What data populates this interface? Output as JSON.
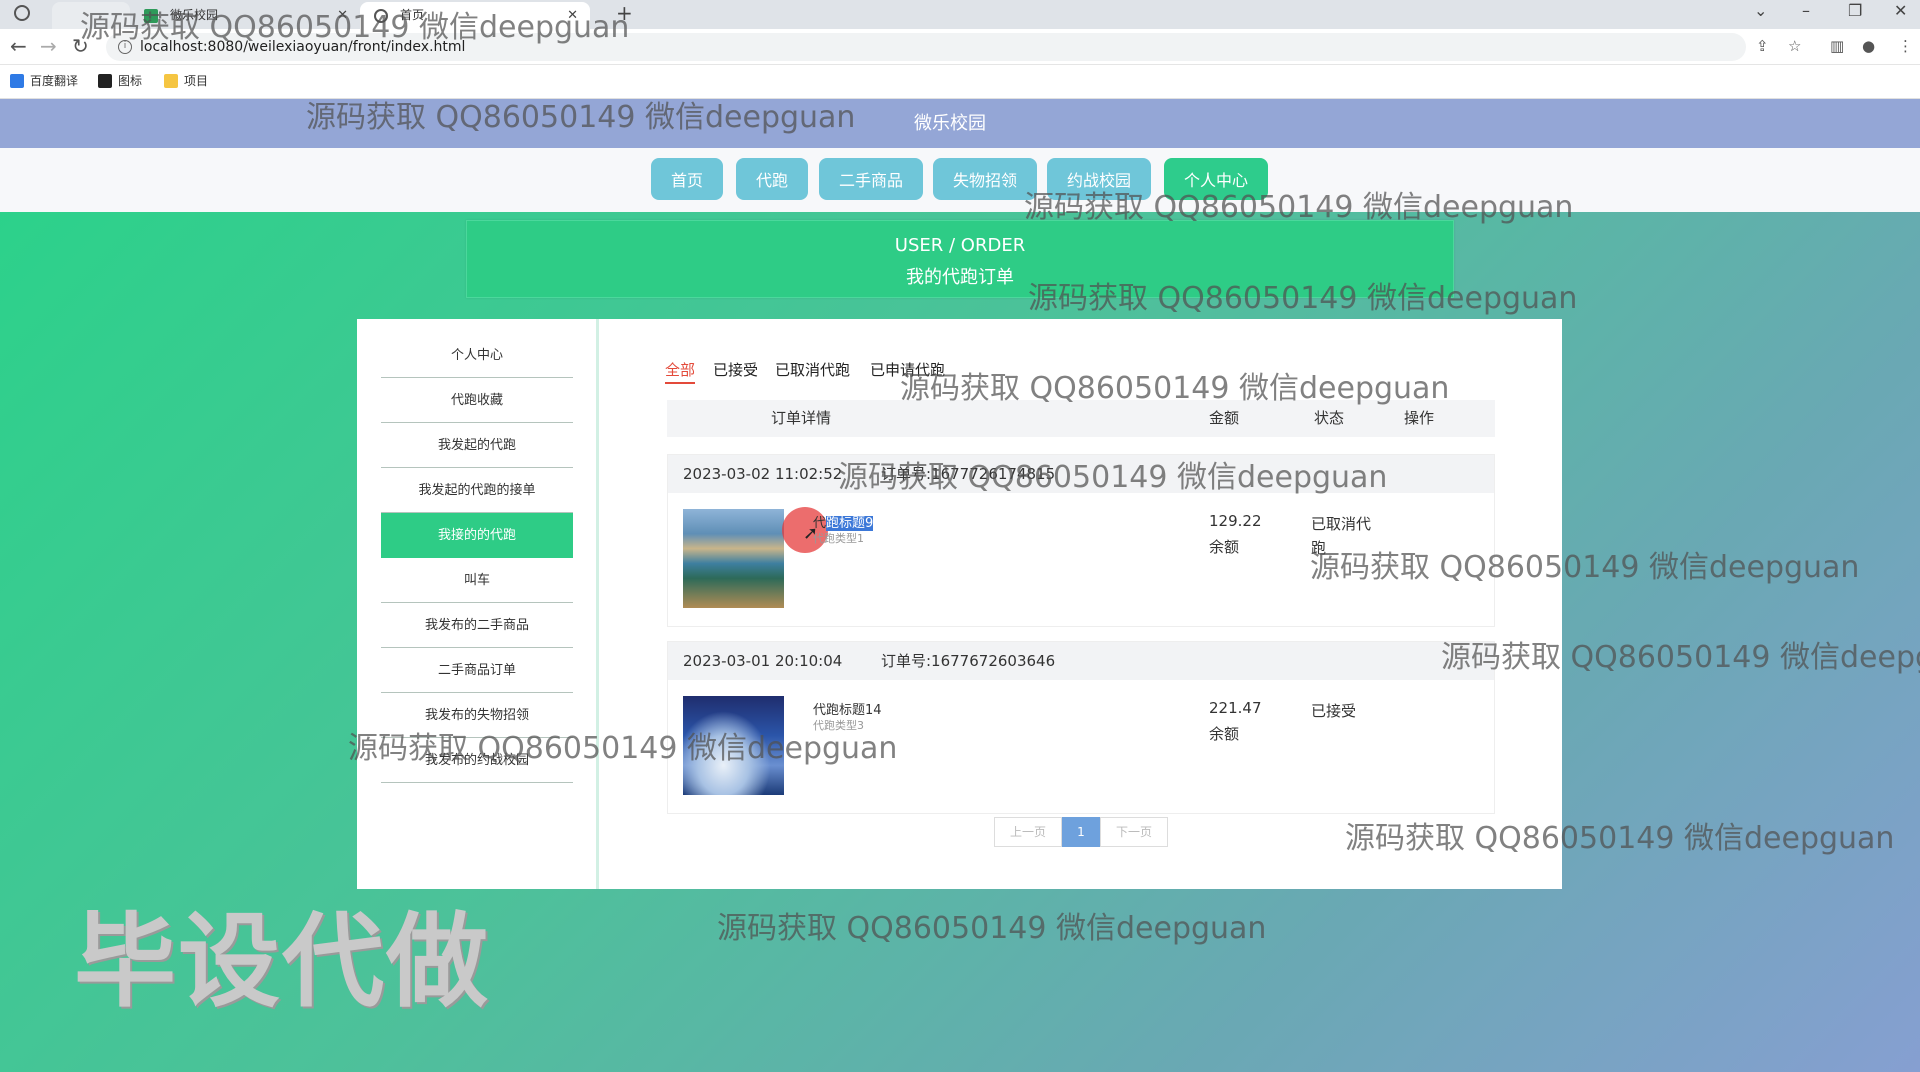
{
  "browser": {
    "tabs": [
      {
        "label": ""
      },
      {
        "label": "微乐校园"
      },
      {
        "label": "首页"
      }
    ],
    "url": "localhost:8080/weilexiaoyuan/front/index.html",
    "bookmarks": [
      "百度翻译",
      "图标",
      "项目"
    ]
  },
  "site": {
    "title": "微乐校园",
    "nav": [
      "首页",
      "代跑",
      "二手商品",
      "失物招领",
      "约战校园",
      "个人中心"
    ]
  },
  "banner": {
    "en": "USER / ORDER",
    "cn": "我的代跑订单"
  },
  "sidebar": {
    "items": [
      "个人中心",
      "代跑收藏",
      "我发起的代跑",
      "我发起的代跑的接单",
      "我接的的代跑",
      "叫车",
      "我发布的二手商品",
      "二手商品订单",
      "我发布的失物招领",
      "我发布的约战校园"
    ]
  },
  "filters": [
    "全部",
    "已接受",
    "已取消代跑",
    "已申请代跑"
  ],
  "table": {
    "headers": [
      "订单详情",
      "金额",
      "状态",
      "操作"
    ]
  },
  "orders": [
    {
      "time": "2023-03-02 11:02:52",
      "number": "订单号:1677726174815",
      "title_prefix": "代",
      "title_selected": "跑标题9",
      "type": "代跑类型1",
      "price": "129.22",
      "balance": "余额",
      "status": "已取消代跑"
    },
    {
      "time": "2023-03-01 20:10:04",
      "number": "订单号:1677672603646",
      "title": "代跑标题14",
      "type": "代跑类型3",
      "price": "221.47",
      "balance": "余额",
      "status": "已接受"
    }
  ],
  "pagination": {
    "prev": "上一页",
    "current": "1",
    "next": "下一页"
  },
  "watermarks": {
    "text": "源码获取 QQ86050149 微信deepguan",
    "big": "毕设代做"
  },
  "colors": {
    "accent": "#2ecc86",
    "header": "#94a6d6",
    "nav_button": "#6fc6d9",
    "filter_active": "#e34a3a"
  }
}
